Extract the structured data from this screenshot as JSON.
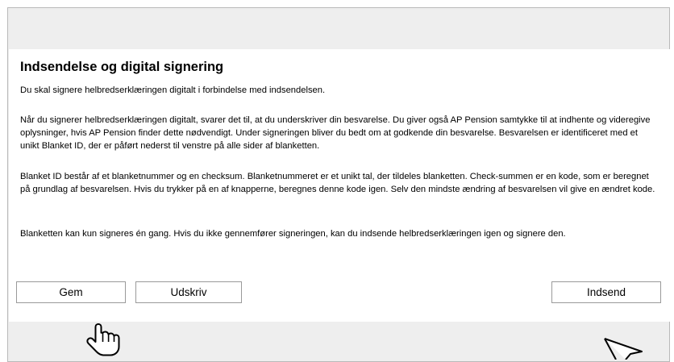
{
  "signing": {
    "title": "Indsendelse og digital signering",
    "paragraphs": [
      "Du skal signere helbredserklæringen digitalt i forbindelse med indsendelsen.",
      "Når du signerer helbredserklæringen digitalt, svarer det til, at du underskriver din besvarelse. Du giver også AP Pension samtykke til at indhente og videregive oplysninger, hvis AP Pension finder dette nødvendigt. Under signeringen bliver du bedt om at godkende din besvarelse. Besvarelsen er identificeret med et unikt Blanket ID, der er påført nederst til venstre på alle sider af blanketten.",
      "Blanket ID består af et blanketnummer og en checksum. Blanketnummeret er et unikt tal, der tildeles blanketten. Check-summen er en kode, som er beregnet på grundlag af besvarelsen. Hvis du trykker på en af knapperne, beregnes denne kode igen. Selv den mindste ændring af besvarelsen vil give en ændret kode.",
      "Blanketten kan kun signeres én gang. Hvis du ikke gennemfører signeringen, kan du indsende helbredserklæringen igen og signere den."
    ]
  },
  "buttons": {
    "save": "Gem",
    "print": "Udskriv",
    "submit": "Indsend"
  },
  "cursors": [
    "hand-pointer-icon",
    "arrow-pointer-icon"
  ]
}
